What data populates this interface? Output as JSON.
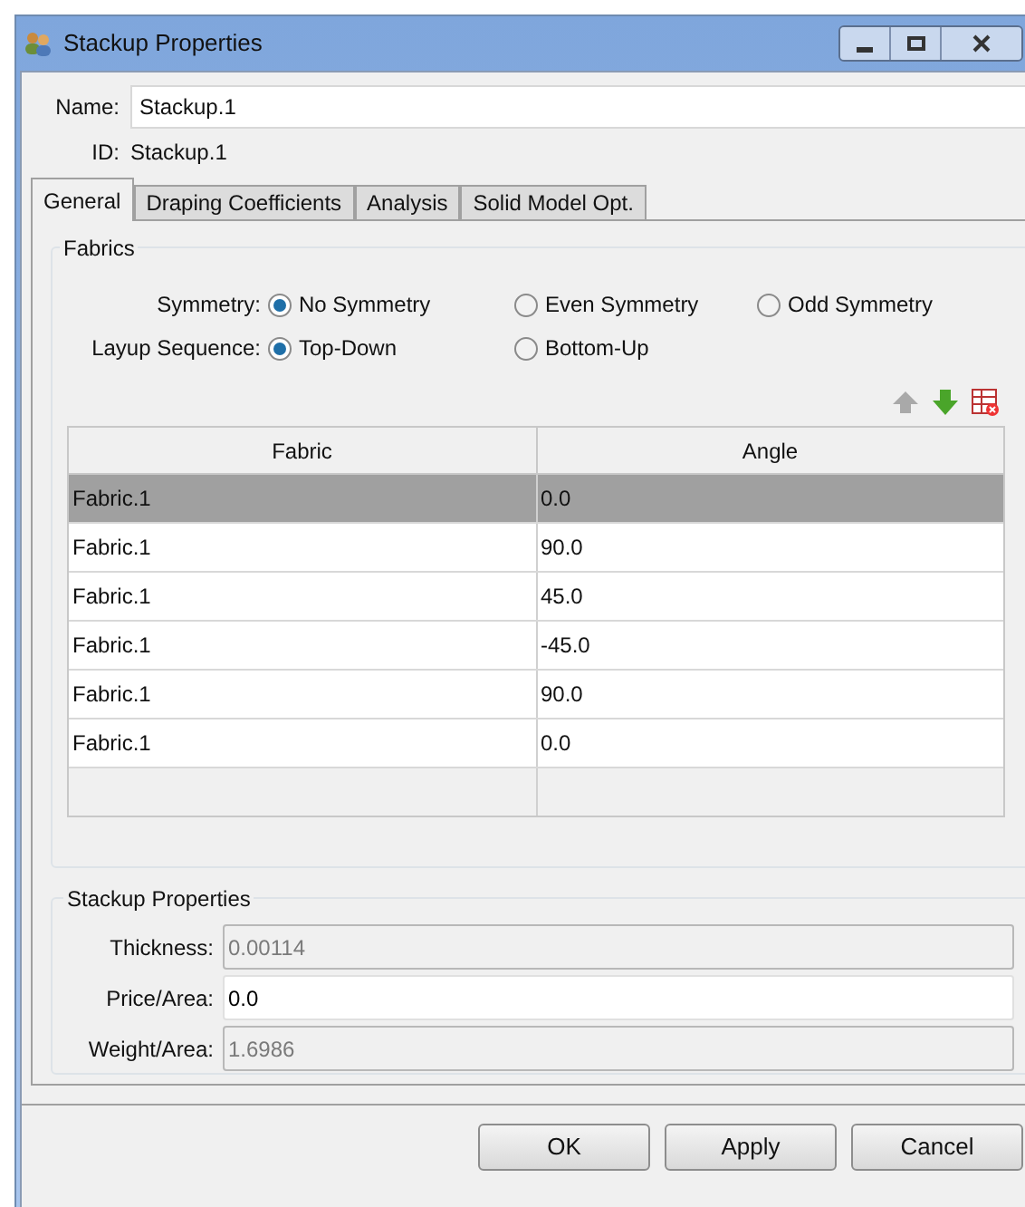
{
  "window": {
    "title": "Stackup Properties"
  },
  "name": {
    "label": "Name:",
    "value": "Stackup.1"
  },
  "id": {
    "label": "ID:",
    "value": "Stackup.1"
  },
  "tabs": [
    {
      "label": "General",
      "selected": true
    },
    {
      "label": "Draping Coefficients",
      "selected": false
    },
    {
      "label": "Analysis",
      "selected": false
    },
    {
      "label": "Solid Model Opt.",
      "selected": false
    }
  ],
  "fabrics": {
    "title": "Fabrics",
    "radio_groups": [
      {
        "label": "Symmetry:",
        "options": [
          {
            "label": "No Symmetry",
            "selected": true
          },
          {
            "label": "Even Symmetry",
            "selected": false
          },
          {
            "label": "Odd Symmetry",
            "selected": false
          }
        ]
      },
      {
        "label": "Layup Sequence:",
        "options": [
          {
            "label": "Top-Down",
            "selected": true
          },
          {
            "label": "Bottom-Up",
            "selected": false
          }
        ]
      }
    ],
    "table": {
      "columns": [
        "Fabric",
        "Angle"
      ],
      "rows": [
        {
          "fabric": "Fabric.1",
          "angle": "0.0",
          "selected": true
        },
        {
          "fabric": "Fabric.1",
          "angle": "90.0",
          "selected": false
        },
        {
          "fabric": "Fabric.1",
          "angle": "45.0",
          "selected": false
        },
        {
          "fabric": "Fabric.1",
          "angle": "-45.0",
          "selected": false
        },
        {
          "fabric": "Fabric.1",
          "angle": "90.0",
          "selected": false
        },
        {
          "fabric": "Fabric.1",
          "angle": "0.0",
          "selected": false
        }
      ]
    }
  },
  "stackup_properties": {
    "title": "Stackup Properties",
    "fields": [
      {
        "label": "Thickness:",
        "value": "0.00114",
        "disabled": true
      },
      {
        "label": "Price/Area:",
        "value": "0.0",
        "disabled": false
      },
      {
        "label": "Weight/Area:",
        "value": "1.6986",
        "disabled": true
      }
    ]
  },
  "buttons": [
    "OK",
    "Apply",
    "Cancel"
  ]
}
